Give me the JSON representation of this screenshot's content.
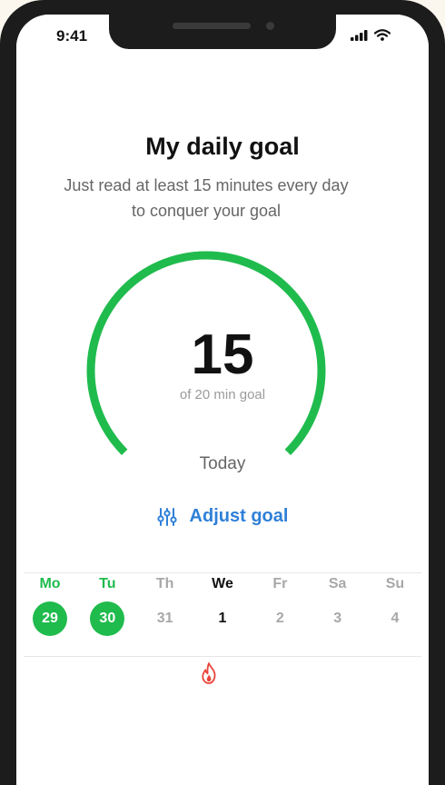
{
  "status": {
    "time": "9:41"
  },
  "goal": {
    "title": "My daily goal",
    "subtitle_line1": "Just read at least 15 minutes every day",
    "subtitle_line2": "to conquer your goal",
    "value": "15",
    "goal_text": "of 20 min goal",
    "progress_fraction": 0.75,
    "period_label": "Today",
    "adjust_label": "Adjust goal"
  },
  "colors": {
    "accent_green": "#20bb4d",
    "link_blue": "#2f80d8",
    "streak_red": "#e8443a"
  },
  "week": [
    {
      "label": "Mo",
      "num": "29",
      "state": "done"
    },
    {
      "label": "Tu",
      "num": "30",
      "state": "done"
    },
    {
      "label": "Th",
      "num": "31",
      "state": "past"
    },
    {
      "label": "We",
      "num": "1",
      "state": "today"
    },
    {
      "label": "Fr",
      "num": "2",
      "state": "future"
    },
    {
      "label": "Sa",
      "num": "3",
      "state": "future"
    },
    {
      "label": "Su",
      "num": "4",
      "state": "future"
    }
  ],
  "icons": {
    "adjust": "sliders-icon",
    "streak": "flame-icon"
  }
}
